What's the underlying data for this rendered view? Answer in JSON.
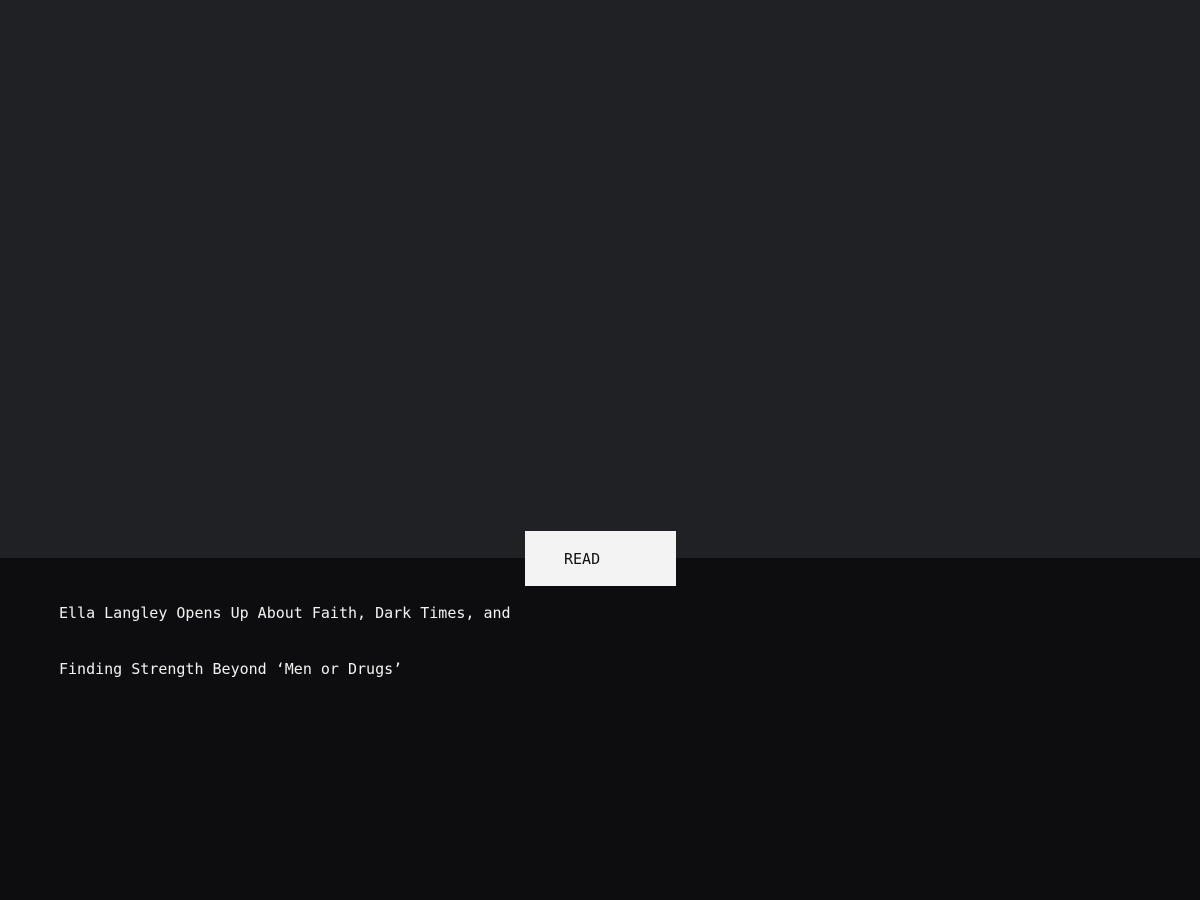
{
  "card": {
    "button_label": "READ",
    "headline_lines": [
      "Ella Langley Opens Up About Faith, Dark Times, and",
      "Finding Strength Beyond ‘Men or Drugs’"
    ]
  },
  "colors": {
    "hero_background": "#202125",
    "panel_background": "#0d0d0f",
    "button_background": "#f3f3f3",
    "text": "#f2f2f2"
  }
}
